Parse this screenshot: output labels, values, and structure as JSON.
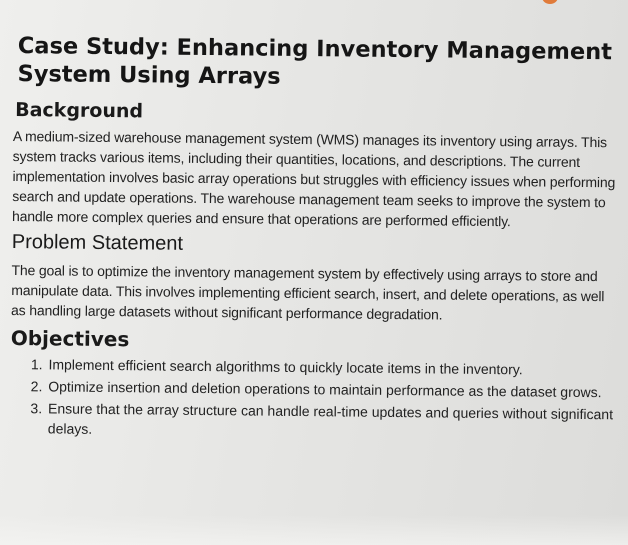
{
  "title": "Case Study: Enhancing Inventory Management System Using Arrays",
  "sections": {
    "background": {
      "heading": "Background",
      "text": "A medium-sized warehouse management system (WMS) manages its inventory using arrays. This system tracks various items, including their quantities, locations, and descriptions. The current implementation involves basic array operations but struggles with efficiency issues when performing search and update operations. The warehouse management team seeks to improve the system to handle more complex queries and ensure that operations are performed efficiently."
    },
    "problem": {
      "heading": "Problem Statement",
      "text": "The goal is to optimize the inventory management system by effectively using arrays to store and manipulate data. This involves implementing efficient search, insert, and delete operations, as well as handling large datasets without significant performance degradation."
    },
    "objectives": {
      "heading": "Objectives",
      "items": [
        "Implement efficient search algorithms to quickly locate items in the inventory.",
        "Optimize insertion and deletion operations to maintain performance as the dataset grows.",
        "Ensure that the array structure can handle real-time updates and queries without significant delays."
      ]
    }
  },
  "colors": {
    "page_background": "#e6e6e4",
    "text": "#1c1c1c",
    "accent_top": "#e07b3a"
  }
}
